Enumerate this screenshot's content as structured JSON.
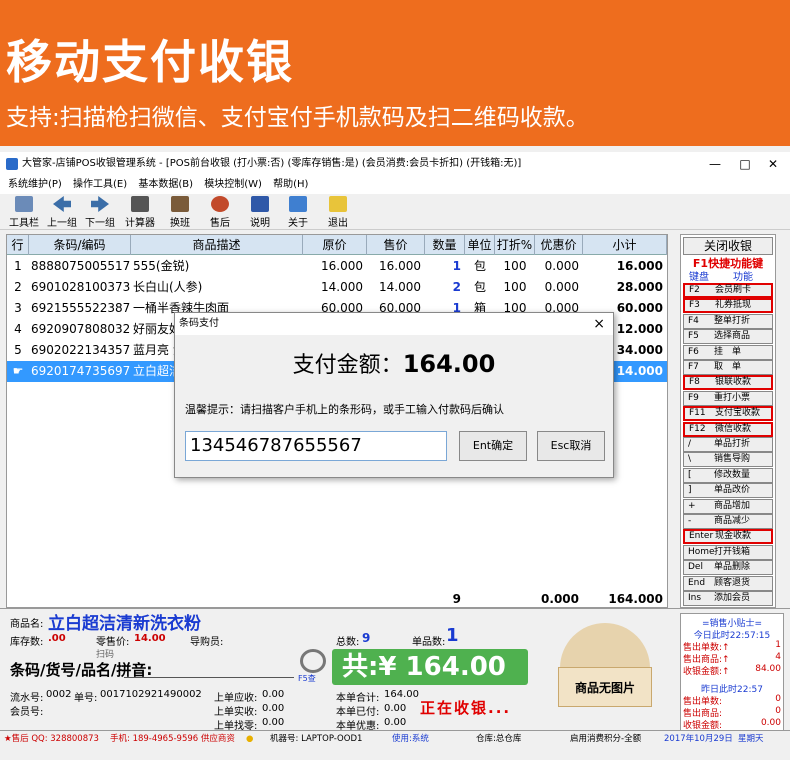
{
  "banner": {
    "title": "移动支付收银",
    "subtitle": "支持:扫描枪扫微信、支付宝付手机款码及扫二维码收款。"
  },
  "window": {
    "title": "大管家-店铺POS收银管理系统 - [POS前台收银 (打小票:否) (零库存销售:是) (会员消费:会员卡折扣) (开钱箱:无)]",
    "controls": [
      "—",
      "□",
      "✕"
    ]
  },
  "menu": [
    "系统维护(P)",
    "操作工具(E)",
    "基本数据(B)",
    "模块控制(W)",
    "帮助(H)"
  ],
  "toolbar": [
    "工具栏",
    "上一组",
    "下一组",
    "计算器",
    "换班",
    "售后",
    "说明",
    "关于",
    "退出"
  ],
  "grid": {
    "headers": [
      "行",
      "条码/编码",
      "商品描述",
      "原价",
      "售价",
      "数量",
      "单位",
      "打折%",
      "优惠价",
      "小计"
    ],
    "rows": [
      {
        "n": "1",
        "code": "8888075005517",
        "desc": "555(金锐)",
        "orig": "16.000",
        "price": "16.000",
        "qty": "1",
        "unit": "包",
        "disc": "100",
        "dprice": "0.000",
        "sub": "16.000"
      },
      {
        "n": "2",
        "code": "6901028100373",
        "desc": "长白山(人参)",
        "orig": "14.000",
        "price": "14.000",
        "qty": "2",
        "unit": "包",
        "disc": "100",
        "dprice": "0.000",
        "sub": "28.000"
      },
      {
        "n": "3",
        "code": "6921555522387",
        "desc": "一桶半香辣牛肉面",
        "orig": "60.000",
        "price": "60.000",
        "qty": "1",
        "unit": "箱",
        "disc": "100",
        "dprice": "0.000",
        "sub": "60.000"
      },
      {
        "n": "4",
        "code": "6920907808032",
        "desc": "好丽友好",
        "orig": "",
        "price": "",
        "qty": "",
        "unit": "",
        "disc": "",
        "dprice": "",
        "sub": "12.000"
      },
      {
        "n": "5",
        "code": "6902022134357",
        "desc": "蓝月亮 洗",
        "orig": "",
        "price": "",
        "qty": "",
        "unit": "",
        "disc": "",
        "dprice": "",
        "sub": "34.000"
      },
      {
        "n": "",
        "code": "6920174735697",
        "desc": "立白超洁",
        "orig": "",
        "price": "",
        "qty": "",
        "unit": "",
        "disc": "",
        "dprice": "",
        "sub": "14.000"
      }
    ],
    "totals": {
      "qty": "9",
      "dprice": "0.000",
      "sub": "164.000"
    }
  },
  "side": {
    "close_label": "关闭收银",
    "f1_label": "F1快捷功能键",
    "kb_label": "键盘",
    "fn_label": "功能",
    "buttons": [
      {
        "key": "F2",
        "label": "会员刷卡",
        "red": true
      },
      {
        "key": "F3",
        "label": "礼券抵现",
        "red": true
      },
      {
        "key": "F4",
        "label": "整单打折",
        "red": false
      },
      {
        "key": "F5",
        "label": "选择商品",
        "red": false
      },
      {
        "key": "F6",
        "label": "挂　单",
        "red": false
      },
      {
        "key": "F7",
        "label": "取　单",
        "red": false
      },
      {
        "key": "F8",
        "label": "银联收款",
        "red": true
      },
      {
        "key": "F9",
        "label": "重打小票",
        "red": false
      },
      {
        "key": "F11",
        "label": "支付宝收款",
        "red": true
      },
      {
        "key": "F12",
        "label": "微信收款",
        "red": true
      },
      {
        "key": "/",
        "label": "单品打折",
        "red": false
      },
      {
        "key": "\\",
        "label": "销售导购",
        "red": false
      },
      {
        "key": "[",
        "label": "修改数量",
        "red": false
      },
      {
        "key": "]",
        "label": "单品改价",
        "red": false
      },
      {
        "key": "+",
        "label": "商品增加",
        "red": false
      },
      {
        "key": "-",
        "label": "商品减少",
        "red": false
      },
      {
        "key": "Enter",
        "label": "现金收款",
        "red": true
      },
      {
        "key": "Home",
        "label": "打开钱箱",
        "red": false
      },
      {
        "key": "Del",
        "label": "单品删除",
        "red": false
      },
      {
        "key": "End",
        "label": "顾客退货",
        "red": false
      },
      {
        "key": "Ins",
        "label": "添加会员",
        "red": false
      }
    ]
  },
  "dialog": {
    "title": "条码支付",
    "amount_label": "支付金额：",
    "amount": "164.00",
    "hint": "温馨提示：请扫描客户手机上的条形码，或手工输入付款码后确认",
    "input_value": "134546787655567",
    "ok_label": "Ent确定",
    "cancel_label": "Esc取消"
  },
  "info": {
    "name_label": "商品名:",
    "name_value": "立白超洁清新洗衣粉",
    "stock_label": "库存数:",
    "stock_value": ".00",
    "retail_label": "零售价:",
    "retail_value": "14.00",
    "guide_label": "导购员:",
    "total_count_label": "总数:",
    "total_count_value": "9",
    "item_count_label": "单品数:",
    "item_count_value": "1",
    "scan_label": "扫码",
    "code_label": "条码/货号/品名/拼音:",
    "query_label": "F5查",
    "pay_label": "共:¥ 164.00",
    "noimg_label": "商品无图片",
    "serial_label": "流水号:",
    "serial_value": "0002",
    "order_label": "单号:",
    "order_value": "0017102921490002",
    "member_label": "会员号:",
    "due_label": "上单应收:",
    "due_value": "0.00",
    "paid_label": "上单实收:",
    "paid_value": "0.00",
    "change_label": "上单找零:",
    "change_value": "0.00",
    "sum_label": "本单合计:",
    "sum_value": "164.00",
    "cur_paid_label": "本单已付:",
    "cur_paid_value": "0.00",
    "cur_disc_label": "本单优惠:",
    "cur_disc_value": "0.00",
    "cashing_label": "正在收银..."
  },
  "tips": {
    "title": "=销售小贴士=",
    "today_label": "今日此时22:57:15",
    "today_rows": [
      {
        "label": "售出单数:↑",
        "value": "1"
      },
      {
        "label": "售出商品:↑",
        "value": "4"
      },
      {
        "label": "收银金额:↑",
        "value": "84.00"
      }
    ],
    "yesterday_label": "昨日此时22:57",
    "yesterday_rows": [
      {
        "label": "售出单数:",
        "value": "0"
      },
      {
        "label": "售出商品:",
        "value": "0"
      },
      {
        "label": "收银金额:",
        "value": "0.00"
      }
    ]
  },
  "status": {
    "seller": "★售后 QQ: 328800873",
    "phone": "手机: 189-4965-9596 供应商资",
    "machine": "机器号: LAPTOP-OOD1",
    "use": "使用:系统",
    "store": "仓库:总仓库",
    "points": "启用消费积分-全额",
    "date": "2017年10月29日",
    "weekday": "星期天"
  },
  "colors": {
    "banner": "#ee6d1e",
    "selection": "#3399ff",
    "accent_red": "#e00000",
    "pay_green": "#4fb14f"
  }
}
